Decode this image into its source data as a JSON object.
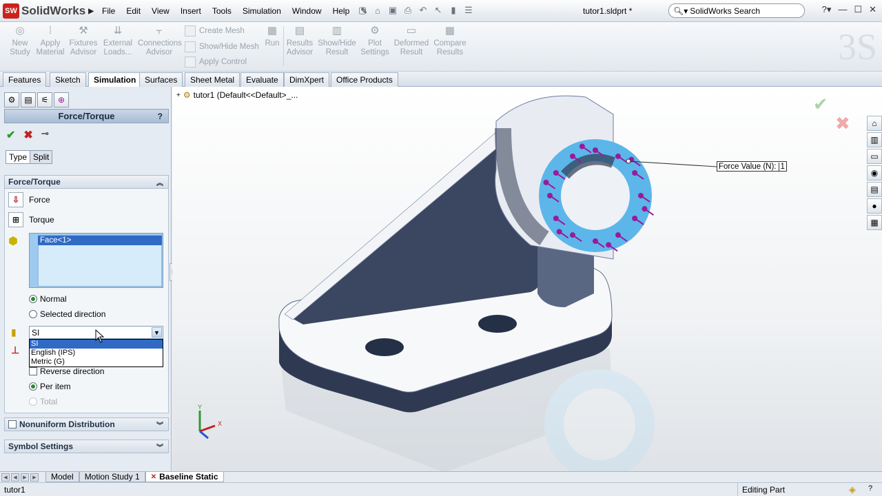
{
  "app": {
    "logo": "SolidWorks",
    "doc_title": "tutor1.sldprt *"
  },
  "menu": [
    "File",
    "Edit",
    "View",
    "Insert",
    "Tools",
    "Simulation",
    "Window",
    "Help"
  ],
  "search": {
    "placeholder": "SolidWorks Search"
  },
  "commands": {
    "new_study": "New\nStudy",
    "apply_material": "Apply\nMaterial",
    "fixtures_advisor": "Fixtures\nAdvisor",
    "external_loads": "External\nLoads...",
    "connections_advisor": "Connections\nAdvisor",
    "create_mesh": "Create Mesh",
    "show_hide_mesh": "Show/Hide Mesh",
    "apply_control": "Apply Control",
    "run": "Run",
    "results_advisor": "Results\nAdvisor",
    "show_hide_result": "Show/Hide\nResult",
    "plot_settings": "Plot\nSettings",
    "deformed_result": "Deformed\nResult",
    "compare_results": "Compare\nResults"
  },
  "tabs": [
    "Features",
    "Sketch",
    "Simulation",
    "Surfaces",
    "Sheet Metal",
    "Evaluate",
    "DimXpert",
    "Office Products"
  ],
  "active_tab": "Simulation",
  "panel": {
    "title": "Force/Torque",
    "help": "?",
    "subtabs": [
      "Type",
      "Split"
    ],
    "group_force_torque": "Force/Torque",
    "force_label": "Force",
    "torque_label": "Torque",
    "selection_item": "Face<1>",
    "normal_label": "Normal",
    "selected_direction_label": "Selected direction",
    "units_value": "SI",
    "units_options": [
      "SI",
      "English (IPS)",
      "Metric (G)"
    ],
    "reverse_direction_label": "Reverse direction",
    "per_item_label": "Per item",
    "total_label": "Total",
    "nonuniform_label": "Nonuniform Distribution",
    "symbol_settings_label": "Symbol Settings"
  },
  "viewport": {
    "tree_label": "tutor1  (Default<<Default>_...",
    "callout_label": "Force Value (N):",
    "callout_value": "1",
    "triad_x": "X",
    "triad_y": "Y"
  },
  "bottom_tabs": [
    "Model",
    "Motion Study 1",
    "Baseline Static"
  ],
  "active_bottom_tab": "Baseline Static",
  "status": {
    "left": "tutor1",
    "right": "Editing Part"
  },
  "colors": {
    "accent": "#316ac5",
    "face_highlight": "#5cb6ea",
    "arrow": "#9a1a9a"
  }
}
